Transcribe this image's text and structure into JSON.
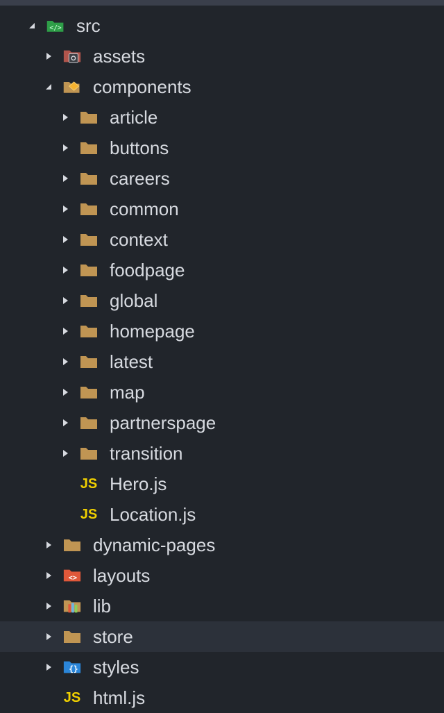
{
  "tree": {
    "items": [
      {
        "label": "src",
        "type": "folder",
        "state": "expanded",
        "icon": "src-folder-icon",
        "level": 0
      },
      {
        "label": "assets",
        "type": "folder",
        "state": "collapsed",
        "icon": "assets-folder-icon",
        "level": 1
      },
      {
        "label": "components",
        "type": "folder",
        "state": "expanded",
        "icon": "components-folder-icon",
        "level": 1
      },
      {
        "label": "article",
        "type": "folder",
        "state": "collapsed",
        "icon": "folder-icon",
        "level": 2
      },
      {
        "label": "buttons",
        "type": "folder",
        "state": "collapsed",
        "icon": "folder-icon",
        "level": 2
      },
      {
        "label": "careers",
        "type": "folder",
        "state": "collapsed",
        "icon": "folder-icon",
        "level": 2
      },
      {
        "label": "common",
        "type": "folder",
        "state": "collapsed",
        "icon": "folder-icon",
        "level": 2
      },
      {
        "label": "context",
        "type": "folder",
        "state": "collapsed",
        "icon": "folder-icon",
        "level": 2
      },
      {
        "label": "foodpage",
        "type": "folder",
        "state": "collapsed",
        "icon": "folder-icon",
        "level": 2
      },
      {
        "label": "global",
        "type": "folder",
        "state": "collapsed",
        "icon": "folder-icon",
        "level": 2
      },
      {
        "label": "homepage",
        "type": "folder",
        "state": "collapsed",
        "icon": "folder-icon",
        "level": 2
      },
      {
        "label": "latest",
        "type": "folder",
        "state": "collapsed",
        "icon": "folder-icon",
        "level": 2
      },
      {
        "label": "map",
        "type": "folder",
        "state": "collapsed",
        "icon": "folder-icon",
        "level": 2
      },
      {
        "label": "partnerspage",
        "type": "folder",
        "state": "collapsed",
        "icon": "folder-icon",
        "level": 2
      },
      {
        "label": "transition",
        "type": "folder",
        "state": "collapsed",
        "icon": "folder-icon",
        "level": 2
      },
      {
        "label": "Hero.js",
        "type": "file",
        "icon": "javascript-file-icon",
        "icon_text": "JS",
        "level": 2
      },
      {
        "label": "Location.js",
        "type": "file",
        "icon": "javascript-file-icon",
        "icon_text": "JS",
        "level": 2
      },
      {
        "label": "dynamic-pages",
        "type": "folder",
        "state": "collapsed",
        "icon": "folder-icon",
        "level": 1
      },
      {
        "label": "layouts",
        "type": "folder",
        "state": "collapsed",
        "icon": "layouts-folder-icon",
        "level": 1
      },
      {
        "label": "lib",
        "type": "folder",
        "state": "collapsed",
        "icon": "lib-folder-icon",
        "level": 1
      },
      {
        "label": "store",
        "type": "folder",
        "state": "collapsed",
        "icon": "folder-icon",
        "level": 1,
        "selected": true
      },
      {
        "label": "styles",
        "type": "folder",
        "state": "collapsed",
        "icon": "styles-folder-icon",
        "level": 1
      },
      {
        "label": "html.js",
        "type": "file",
        "icon": "javascript-file-icon",
        "icon_text": "JS",
        "level": 1
      }
    ]
  },
  "colors": {
    "background": "#21252b",
    "selected_row": "#2c313a",
    "text": "#d7dae0",
    "folder": "#c09553",
    "js_icon": "#f0d000",
    "src_folder": "#2e9e48",
    "components_badge": "#f6b330",
    "assets_folder": "#b0554c",
    "layouts_folder": "#e0583a",
    "styles_folder": "#2b86d9"
  }
}
